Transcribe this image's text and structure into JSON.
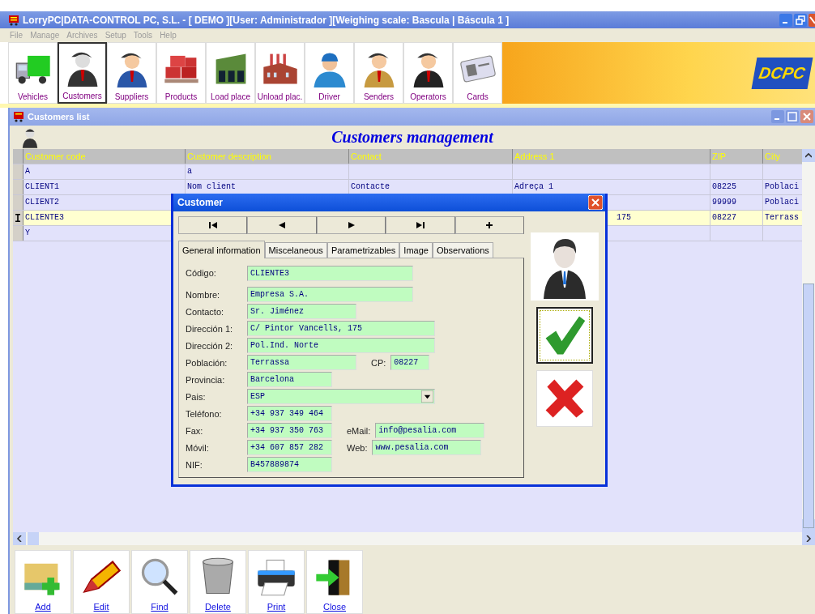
{
  "window": {
    "title": "LorryPC|DATA-CONTROL PC, S.L. - [ DEMO ][User: Administrador ][Weighing scale: Bascula | Báscula 1 ]"
  },
  "menu": [
    {
      "label": "File",
      "disabled": true
    },
    {
      "label": "Manage",
      "disabled": true
    },
    {
      "label": "Archives",
      "disabled": true
    },
    {
      "label": "Setup",
      "disabled": true
    },
    {
      "label": "Tools",
      "disabled": true
    },
    {
      "label": "Help",
      "disabled": true
    }
  ],
  "toolbar": [
    {
      "label": "Vehicles",
      "selected": false
    },
    {
      "label": "Customers",
      "selected": true
    },
    {
      "label": "Suppliers",
      "selected": false
    },
    {
      "label": "Products",
      "selected": false
    },
    {
      "label": "Load place",
      "selected": false
    },
    {
      "label": "Unload plac.",
      "selected": false
    },
    {
      "label": "Driver",
      "selected": false
    },
    {
      "label": "Senders",
      "selected": false
    },
    {
      "label": "Operators",
      "selected": false
    },
    {
      "label": "Cards",
      "selected": false
    }
  ],
  "logo": {
    "text": "DCPC"
  },
  "child_window": {
    "title": "Customers list",
    "heading": "Customers management"
  },
  "table": {
    "columns": [
      "Customer code",
      "Customer description",
      "Contact",
      "Address 1",
      "ZIP",
      "City"
    ],
    "rows": [
      {
        "cells": [
          "A",
          "a",
          "",
          "",
          "",
          ""
        ],
        "selected": false
      },
      {
        "cells": [
          "CLIENT1",
          "Nom client",
          "Contacte",
          "Adreça 1",
          "08225",
          "Poblaci"
        ],
        "selected": false
      },
      {
        "cells": [
          "CLIENT2",
          "",
          "",
          "",
          "99999",
          "Poblaci"
        ],
        "selected": false
      },
      {
        "cells": [
          "CLIENTE3",
          "",
          "",
          "175",
          "08227",
          "Terrass"
        ],
        "selected": true
      },
      {
        "cells": [
          "Y",
          "",
          "",
          "",
          "",
          ""
        ],
        "selected": false
      }
    ]
  },
  "actions": [
    "Add",
    "Edit",
    "Find",
    "Delete",
    "Print",
    "Close"
  ],
  "dialog": {
    "title": "Customer",
    "tabs": [
      {
        "label": "General information",
        "selected": true
      },
      {
        "label": "Miscelaneous",
        "selected": false
      },
      {
        "label": "Parametrizables",
        "selected": false
      },
      {
        "label": "Image",
        "selected": false
      },
      {
        "label": "Observations",
        "selected": false
      }
    ],
    "rows": [
      {
        "fields": [
          {
            "label": "Código:",
            "value": "CLIENTE3",
            "kind": "text"
          }
        ]
      },
      {
        "fields": [
          {
            "label": "Nombre:",
            "value": "Empresa S.A.",
            "kind": "text"
          }
        ]
      },
      {
        "fields": [
          {
            "label": "Contacto:",
            "value": "Sr. Jiménez",
            "kind": "text"
          }
        ]
      },
      {
        "fields": [
          {
            "label": "Dirección 1:",
            "value": "C/ Pintor Vancells, 175",
            "kind": "text"
          }
        ]
      },
      {
        "fields": [
          {
            "label": "Dirección 2:",
            "value": "Pol.Ind. Norte",
            "kind": "text"
          }
        ]
      },
      {
        "fields": [
          {
            "label": "Población:",
            "value": "Terrassa",
            "kind": "text"
          },
          {
            "label": "CP:",
            "value": "08227",
            "kind": "text"
          }
        ]
      },
      {
        "fields": [
          {
            "label": "Provincia:",
            "value": "Barcelona",
            "kind": "text"
          }
        ]
      },
      {
        "fields": [
          {
            "label": "Pais:",
            "value": "ESP",
            "kind": "select"
          }
        ]
      },
      {
        "fields": [
          {
            "label": "Teléfono:",
            "value": "+34 937 349 464",
            "kind": "text"
          }
        ]
      },
      {
        "fields": [
          {
            "label": "Fax:",
            "value": "+34 937 350 763",
            "kind": "text"
          },
          {
            "label": "eMail:",
            "value": "info@pesalia.com",
            "kind": "text"
          }
        ]
      },
      {
        "fields": [
          {
            "label": "Móvil:",
            "value": "+34 607 857 282",
            "kind": "text"
          },
          {
            "label": "Web:",
            "value": "www.pesalia.com",
            "kind": "text"
          }
        ]
      },
      {
        "fields": [
          {
            "label": "NIF:",
            "value": "B457889874",
            "kind": "text"
          }
        ]
      }
    ]
  }
}
